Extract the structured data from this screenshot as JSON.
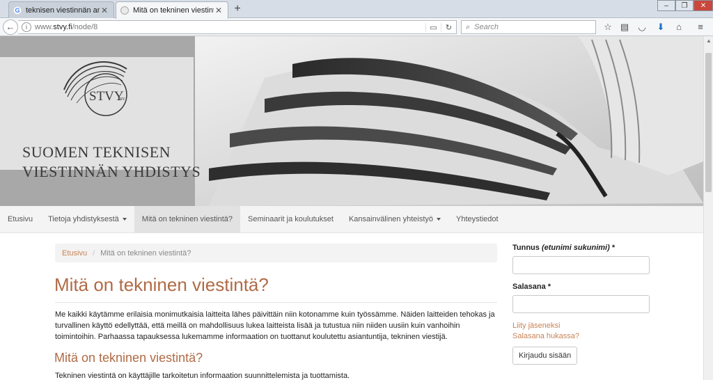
{
  "browser": {
    "tabs": [
      {
        "label": "teknisen viestinnän ammat...",
        "active": false,
        "favicon": "google-icon"
      },
      {
        "label": "Mitä on tekninen viestintä?...",
        "active": true,
        "favicon": "page-icon"
      }
    ],
    "url_prefix": "www.",
    "url_host": "stvy.fi",
    "url_path": "/node/8",
    "search_placeholder": "Search"
  },
  "site": {
    "logo_text": "STVY",
    "logo_suffix": "RY",
    "name_line1": "SUOMEN TEKNISEN",
    "name_line2": "VIESTINNÄN YHDISTYS"
  },
  "nav": {
    "items": [
      {
        "label": "Etusivu"
      },
      {
        "label": "Tietoja yhdistyksestä"
      },
      {
        "label": "Mitä on tekninen viestintä?"
      },
      {
        "label": "Seminaarit ja koulutukset"
      },
      {
        "label": "Kansainvälinen yhteistyö"
      },
      {
        "label": "Yhteystiedot"
      }
    ]
  },
  "breadcrumb": {
    "home": "Etusivu",
    "separator": "/",
    "current": "Mitä on tekninen viestintä?"
  },
  "content": {
    "title": "Mitä on tekninen viestintä?",
    "intro": "Me kaikki käytämme erilaisia monimutkaisia laitteita lähes päivittäin niin kotonamme kuin työssämme. Näiden laitteiden tehokas ja turvallinen käyttö edellyttää, että meillä on mahdollisuus lukea laitteista lisää ja tutustua niin niiden uusiin kuin vanhoihin toimintoihin. Parhaassa tapauksessa lukemamme informaation on tuottanut koulutettu asiantuntija, tekninen viestijä.",
    "subtitle": "Mitä on tekninen viestintä?",
    "paragraph2": "Tekninen viestintä on käyttäjille tarkoitetun informaation suunnittelemista ja tuottamista."
  },
  "login": {
    "username_label": "Tunnus",
    "username_hint": "(etunimi sukunimi)",
    "required_mark": "*",
    "username_value": "",
    "password_label": "Salasana",
    "password_value": "",
    "join_link": "Liity jäseneksi",
    "forgot_link": "Salasana hukassa?",
    "submit_label": "Kirjaudu sisään"
  },
  "colors": {
    "accent": "#b06a45",
    "link": "#c78356"
  }
}
